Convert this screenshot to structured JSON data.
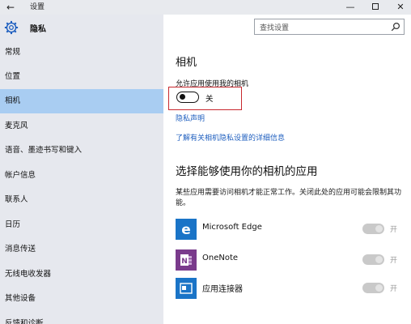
{
  "window": {
    "title": "设置",
    "back_glyph": "←",
    "minimize_glyph": "—",
    "close_glyph": "✕"
  },
  "sidebar": {
    "header": "隐私",
    "items": [
      {
        "label": "常规",
        "active": false
      },
      {
        "label": "位置",
        "active": false
      },
      {
        "label": "相机",
        "active": true
      },
      {
        "label": "麦克风",
        "active": false
      },
      {
        "label": "语音、墨迹书写和键入",
        "active": false
      },
      {
        "label": "帐户信息",
        "active": false
      },
      {
        "label": "联系人",
        "active": false
      },
      {
        "label": "日历",
        "active": false
      },
      {
        "label": "消息传送",
        "active": false
      },
      {
        "label": "无线电收发器",
        "active": false
      },
      {
        "label": "其他设备",
        "active": false
      },
      {
        "label": "反馈和诊断",
        "active": false
      }
    ]
  },
  "search": {
    "placeholder": "查找设置",
    "icon": "search-icon"
  },
  "main": {
    "title": "相机",
    "allow_label": "允许应用使用我的相机",
    "toggle_state": "关",
    "privacy_link": "隐私声明",
    "learn_link": "了解有关相机隐私设置的详细信息",
    "section_title": "选择能够使用你的相机的应用",
    "section_desc": "某些应用需要访问相机才能正常工作。关闭此处的应用可能会限制其功能。",
    "apps": [
      {
        "name": "Microsoft Edge",
        "state": "开",
        "icon": "edge-icon",
        "color": "#1a74c7"
      },
      {
        "name": "OneNote",
        "state": "开",
        "icon": "onenote-icon",
        "color": "#7a3b8c"
      },
      {
        "name": "应用连接器",
        "state": "开",
        "icon": "app-connector-icon",
        "color": "#1a74c7"
      }
    ]
  },
  "colors": {
    "accent": "#1f5fbf",
    "sidebar_bg": "#e6e8ee",
    "active_item": "#a9cdf2",
    "highlight_border": "#c8282e"
  }
}
